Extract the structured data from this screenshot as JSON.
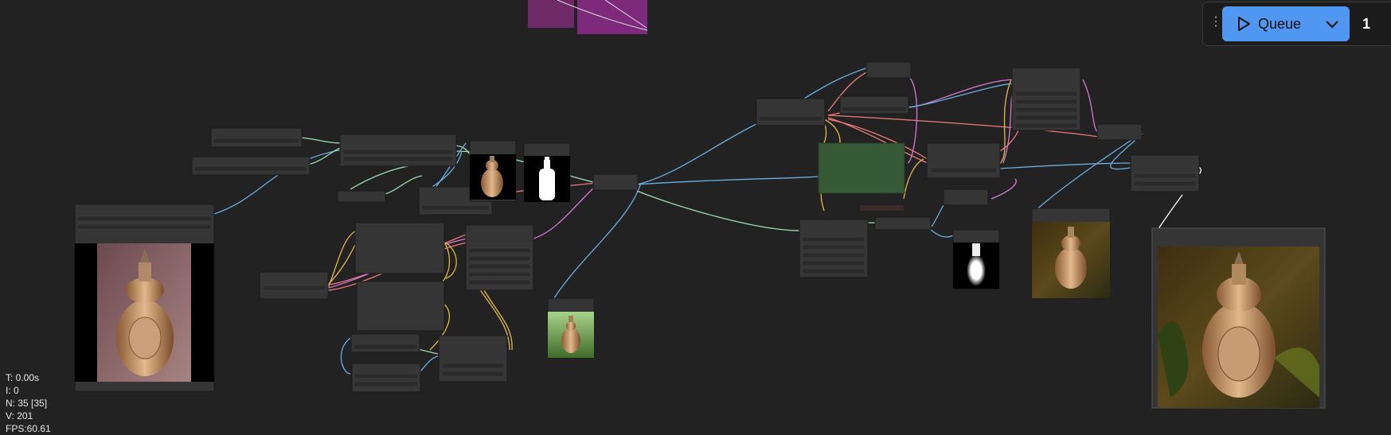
{
  "toolbar": {
    "menu_icon": "vertical-dots-icon",
    "queue_label": "Queue",
    "play_icon": "play-icon",
    "dropdown_icon": "chevron-down-icon",
    "batch_count": "1",
    "accent": "#4f97f0"
  },
  "stats": {
    "time": "T: 0.00s",
    "iterations": "I: 0",
    "nodes": "N: 35 [35]",
    "vertices": "V: 201",
    "fps": "FPS:60.61"
  },
  "colors": {
    "background": "#222222",
    "node": "#353535",
    "group_green": "#355a35",
    "group_purple": "#7a2a7a"
  }
}
